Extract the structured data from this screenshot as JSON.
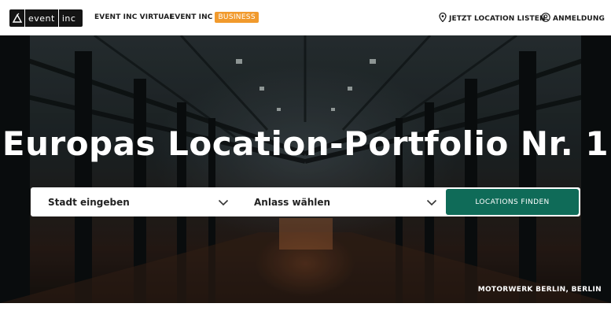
{
  "header": {
    "logo_text": "event inc",
    "logo_word_1": "event",
    "logo_word_2": "inc",
    "nav": {
      "virtual_label": "EVENT INC VIRTUAL",
      "business_label": "EVENT INC",
      "business_badge": "BUSINESS",
      "listen_label": "JETZT LOCATION LISTEN",
      "login_label": "ANMELDUNG"
    }
  },
  "hero": {
    "title": "Europas Location-Portfolio Nr. 1",
    "credit": "MOTORWERK BERLIN, BERLIN"
  },
  "search": {
    "city_label": "Stadt eingeben",
    "event_label": "Anlass wählen",
    "find_button_label": "LOCATIONS FINDEN"
  },
  "colors": {
    "badge": "#f19a2d",
    "primary_button": "#0f6b58",
    "text_dark": "#1c1c1c"
  },
  "icons": {
    "location_pin": "location-pin-icon",
    "user_circle": "user-circle-icon",
    "chevron_down": "chevron-down-icon"
  }
}
